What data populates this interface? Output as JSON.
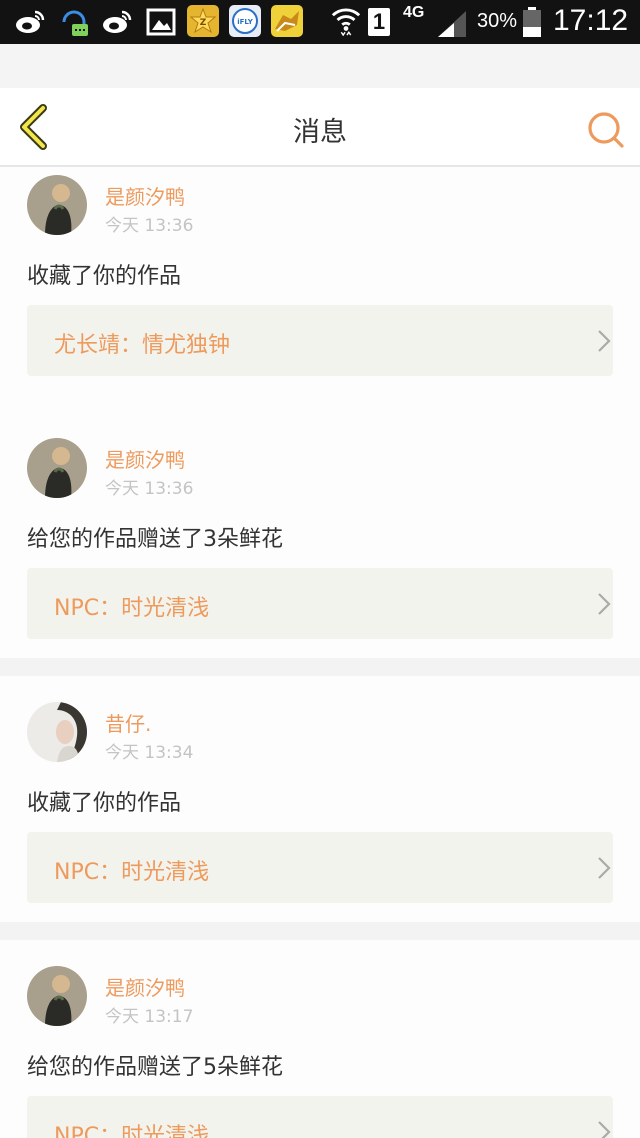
{
  "status_bar": {
    "icons": [
      "weibo-icon",
      "chat-bubble-icon",
      "weibo-icon",
      "image-icon",
      "qzone-icon",
      "ifly-icon",
      "game-icon",
      "wifi-icon",
      "sim-icon",
      "signal-icon",
      "battery-icon"
    ],
    "ifly_label": "iFLY",
    "sim_label": "1",
    "network": "4G",
    "battery_percent": "30%",
    "time": "17:12"
  },
  "header": {
    "title": "消息",
    "back_icon": "chevron-left-icon",
    "search_icon": "search-icon",
    "accent_color": "#ee9a5c"
  },
  "messages": [
    {
      "username": "是颜汐鸭",
      "time": "今天 13:36",
      "action": "收藏了你的作品",
      "work_author": "尤长靖",
      "separator": "：",
      "work_title": "情尤独钟"
    },
    {
      "username": "是颜汐鸭",
      "time": "今天 13:36",
      "action": "给您的作品赠送了3朵鲜花",
      "work_author": "NPC",
      "separator": "：",
      "work_title": "时光清浅"
    },
    {
      "username": "昔仔.",
      "time": "今天 13:34",
      "action": "收藏了你的作品",
      "work_author": "NPC",
      "separator": "：",
      "work_title": "时光清浅"
    },
    {
      "username": "是颜汐鸭",
      "time": "今天 13:17",
      "action": "给您的作品赠送了5朵鲜花",
      "work_author": "NPC",
      "separator": "：",
      "work_title": "时光清浅"
    }
  ]
}
